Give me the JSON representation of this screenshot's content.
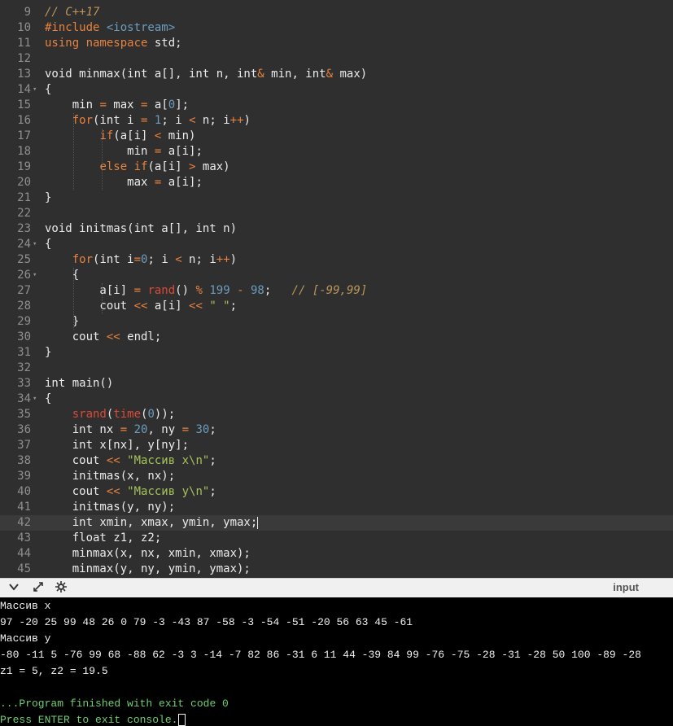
{
  "editor": {
    "lines": [
      {
        "n": "9",
        "fold": "",
        "tokens": [
          [
            "cmt",
            "// C++17"
          ]
        ]
      },
      {
        "n": "10",
        "fold": "",
        "tokens": [
          [
            "pre",
            "#include "
          ],
          [
            "inc",
            "<iostream>"
          ]
        ]
      },
      {
        "n": "11",
        "fold": "",
        "tokens": [
          [
            "ctl",
            "using namespace"
          ],
          [
            "kw",
            " std;"
          ]
        ]
      },
      {
        "n": "12",
        "fold": "",
        "tokens": []
      },
      {
        "n": "13",
        "fold": "",
        "tokens": [
          [
            "kw",
            "void minmax(int a[], int n, int"
          ],
          [
            "op",
            "&"
          ],
          [
            "kw",
            " min, int"
          ],
          [
            "op",
            "&"
          ],
          [
            "kw",
            " max)"
          ]
        ]
      },
      {
        "n": "14",
        "fold": "▾",
        "tokens": [
          [
            "kw",
            "{"
          ]
        ]
      },
      {
        "n": "15",
        "fold": "",
        "tokens": [
          [
            "kw",
            "    min "
          ],
          [
            "op",
            "="
          ],
          [
            "kw",
            " max "
          ],
          [
            "op",
            "="
          ],
          [
            "kw",
            " a["
          ],
          [
            "num",
            "0"
          ],
          [
            "kw",
            "];"
          ]
        ]
      },
      {
        "n": "16",
        "fold": "",
        "tokens": [
          [
            "kw",
            "    "
          ],
          [
            "ctl",
            "for"
          ],
          [
            "kw",
            "(int i "
          ],
          [
            "op",
            "="
          ],
          [
            "kw",
            " "
          ],
          [
            "num",
            "1"
          ],
          [
            "kw",
            "; i "
          ],
          [
            "op",
            "<"
          ],
          [
            "kw",
            " n; i"
          ],
          [
            "op",
            "++"
          ],
          [
            "kw",
            ")"
          ]
        ]
      },
      {
        "n": "17",
        "fold": "",
        "tokens": [
          [
            "kw",
            "        "
          ],
          [
            "ctl",
            "if"
          ],
          [
            "kw",
            "(a[i] "
          ],
          [
            "op",
            "<"
          ],
          [
            "kw",
            " min)"
          ]
        ]
      },
      {
        "n": "18",
        "fold": "",
        "tokens": [
          [
            "kw",
            "            min "
          ],
          [
            "op",
            "="
          ],
          [
            "kw",
            " a[i];"
          ]
        ]
      },
      {
        "n": "19",
        "fold": "",
        "tokens": [
          [
            "kw",
            "        "
          ],
          [
            "ctl",
            "else if"
          ],
          [
            "kw",
            "(a[i] "
          ],
          [
            "op",
            ">"
          ],
          [
            "kw",
            " max)"
          ]
        ]
      },
      {
        "n": "20",
        "fold": "",
        "tokens": [
          [
            "kw",
            "            max "
          ],
          [
            "op",
            "="
          ],
          [
            "kw",
            " a[i];"
          ]
        ]
      },
      {
        "n": "21",
        "fold": "",
        "tokens": [
          [
            "kw",
            "}"
          ]
        ]
      },
      {
        "n": "22",
        "fold": "",
        "tokens": []
      },
      {
        "n": "23",
        "fold": "",
        "tokens": [
          [
            "kw",
            "void initmas(int a[], int n)"
          ]
        ]
      },
      {
        "n": "24",
        "fold": "▾",
        "tokens": [
          [
            "kw",
            "{"
          ]
        ]
      },
      {
        "n": "25",
        "fold": "",
        "tokens": [
          [
            "kw",
            "    "
          ],
          [
            "ctl",
            "for"
          ],
          [
            "kw",
            "(int i"
          ],
          [
            "op",
            "="
          ],
          [
            "num",
            "0"
          ],
          [
            "kw",
            "; i "
          ],
          [
            "op",
            "<"
          ],
          [
            "kw",
            " n; i"
          ],
          [
            "op",
            "++"
          ],
          [
            "kw",
            ")"
          ]
        ]
      },
      {
        "n": "26",
        "fold": "▾",
        "tokens": [
          [
            "kw",
            "    {"
          ]
        ]
      },
      {
        "n": "27",
        "fold": "",
        "tokens": [
          [
            "kw",
            "        a[i] "
          ],
          [
            "op",
            "="
          ],
          [
            "kw",
            " "
          ],
          [
            "fn",
            "rand"
          ],
          [
            "kw",
            "() "
          ],
          [
            "op",
            "%"
          ],
          [
            "kw",
            " "
          ],
          [
            "num",
            "199"
          ],
          [
            "kw",
            " "
          ],
          [
            "op",
            "-"
          ],
          [
            "kw",
            " "
          ],
          [
            "num",
            "98"
          ],
          [
            "kw",
            ";   "
          ],
          [
            "cmt",
            "// [-99,99]"
          ]
        ]
      },
      {
        "n": "28",
        "fold": "",
        "tokens": [
          [
            "kw",
            "        cout "
          ],
          [
            "op",
            "<<"
          ],
          [
            "kw",
            " a[i] "
          ],
          [
            "op",
            "<<"
          ],
          [
            "kw",
            " "
          ],
          [
            "str",
            "\" \""
          ],
          [
            "kw",
            ";"
          ]
        ]
      },
      {
        "n": "29",
        "fold": "",
        "tokens": [
          [
            "kw",
            "    }"
          ]
        ]
      },
      {
        "n": "30",
        "fold": "",
        "tokens": [
          [
            "kw",
            "    cout "
          ],
          [
            "op",
            "<<"
          ],
          [
            "kw",
            " endl;"
          ]
        ]
      },
      {
        "n": "31",
        "fold": "",
        "tokens": [
          [
            "kw",
            "}"
          ]
        ]
      },
      {
        "n": "32",
        "fold": "",
        "tokens": []
      },
      {
        "n": "33",
        "fold": "",
        "tokens": [
          [
            "kw",
            "int main()"
          ]
        ]
      },
      {
        "n": "34",
        "fold": "▾",
        "tokens": [
          [
            "kw",
            "{"
          ]
        ]
      },
      {
        "n": "35",
        "fold": "",
        "tokens": [
          [
            "kw",
            "    "
          ],
          [
            "fn",
            "srand"
          ],
          [
            "kw",
            "("
          ],
          [
            "fn",
            "time"
          ],
          [
            "kw",
            "("
          ],
          [
            "num",
            "0"
          ],
          [
            "kw",
            "));"
          ]
        ]
      },
      {
        "n": "36",
        "fold": "",
        "tokens": [
          [
            "kw",
            "    int nx "
          ],
          [
            "op",
            "="
          ],
          [
            "kw",
            " "
          ],
          [
            "num",
            "20"
          ],
          [
            "kw",
            ", ny "
          ],
          [
            "op",
            "="
          ],
          [
            "kw",
            " "
          ],
          [
            "num",
            "30"
          ],
          [
            "kw",
            ";"
          ]
        ]
      },
      {
        "n": "37",
        "fold": "",
        "tokens": [
          [
            "kw",
            "    int x[nx], y[ny];"
          ]
        ]
      },
      {
        "n": "38",
        "fold": "",
        "tokens": [
          [
            "kw",
            "    cout "
          ],
          [
            "op",
            "<<"
          ],
          [
            "kw",
            " "
          ],
          [
            "str",
            "\"Массив x\\n\""
          ],
          [
            "kw",
            ";"
          ]
        ]
      },
      {
        "n": "39",
        "fold": "",
        "tokens": [
          [
            "kw",
            "    initmas(x, nx);"
          ]
        ]
      },
      {
        "n": "40",
        "fold": "",
        "tokens": [
          [
            "kw",
            "    cout "
          ],
          [
            "op",
            "<<"
          ],
          [
            "kw",
            " "
          ],
          [
            "str",
            "\"Массив y\\n\""
          ],
          [
            "kw",
            ";"
          ]
        ]
      },
      {
        "n": "41",
        "fold": "",
        "tokens": [
          [
            "kw",
            "    initmas(y, ny);"
          ]
        ]
      },
      {
        "n": "42",
        "fold": "",
        "active": true,
        "tokens": [
          [
            "kw",
            "    int xmin, xmax, ymin, ymax;"
          ]
        ]
      },
      {
        "n": "43",
        "fold": "",
        "tokens": [
          [
            "kw",
            "    float z1, z2;"
          ]
        ]
      },
      {
        "n": "44",
        "fold": "",
        "tokens": [
          [
            "kw",
            "    minmax(x, nx, xmin, xmax);"
          ]
        ]
      },
      {
        "n": "45",
        "fold": "",
        "tokens": [
          [
            "kw",
            "    minmax(y, ny, ymin, ymax);"
          ]
        ]
      }
    ]
  },
  "toolbar": {
    "icons": [
      "chevron-down-icon",
      "expand-icon",
      "settings-icon"
    ],
    "input_label": "input"
  },
  "console": {
    "lines": [
      {
        "text": "Массив x",
        "color": "white"
      },
      {
        "text": "97 -20 25 99 48 26 0 79 -3 -43 87 -58 -3 -54 -51 -20 56 63 45 -61",
        "color": "white"
      },
      {
        "text": "Массив y",
        "color": "white"
      },
      {
        "text": "-80 -11 5 -76 99 68 -88 62 -3 3 -14 -7 82 86 -31 6 11 44 -39 84 99 -76 -75 -28 -31 -28 50 100 -89 -28",
        "color": "white"
      },
      {
        "text": "z1 = 5, z2 = 19.5",
        "color": "white"
      },
      {
        "text": "",
        "color": "white"
      },
      {
        "text": "...Program finished with exit code 0",
        "color": "green"
      },
      {
        "text": "Press ENTER to exit console.",
        "color": "green",
        "cursor": true
      }
    ]
  }
}
